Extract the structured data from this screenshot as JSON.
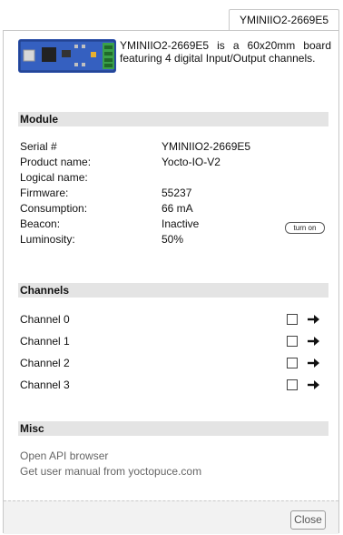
{
  "tab": {
    "label": "YMINIIO2-2669E5"
  },
  "header": {
    "description": "YMINIIO2-2669E5 is a 60x20mm board featuring 4 digital Input/Output channels."
  },
  "module": {
    "title": "Module",
    "rows": [
      {
        "label": "Serial #",
        "value": "YMINIIO2-2669E5"
      },
      {
        "label": "Product name:",
        "value": "Yocto-IO-V2"
      },
      {
        "label": "Logical name:",
        "value": ""
      },
      {
        "label": "Firmware:",
        "value": "55237"
      },
      {
        "label": "Consumption:",
        "value": "66 mA"
      },
      {
        "label": "Beacon:",
        "value": "Inactive"
      },
      {
        "label": "Luminosity:",
        "value": "50%"
      }
    ],
    "beacon_button": "turn on"
  },
  "channels": {
    "title": "Channels",
    "items": [
      {
        "label": "Channel 0",
        "icon": "arrow-right-icon"
      },
      {
        "label": "Channel 1",
        "icon": "arrow-right-icon"
      },
      {
        "label": "Channel 2",
        "icon": "arrow-right-icon"
      },
      {
        "label": "Channel 3",
        "icon": "arrow-right-icon"
      }
    ]
  },
  "misc": {
    "title": "Misc",
    "links": [
      "Open API browser",
      "Get user manual from yoctopuce.com"
    ]
  },
  "footer": {
    "close_label": "Close"
  }
}
